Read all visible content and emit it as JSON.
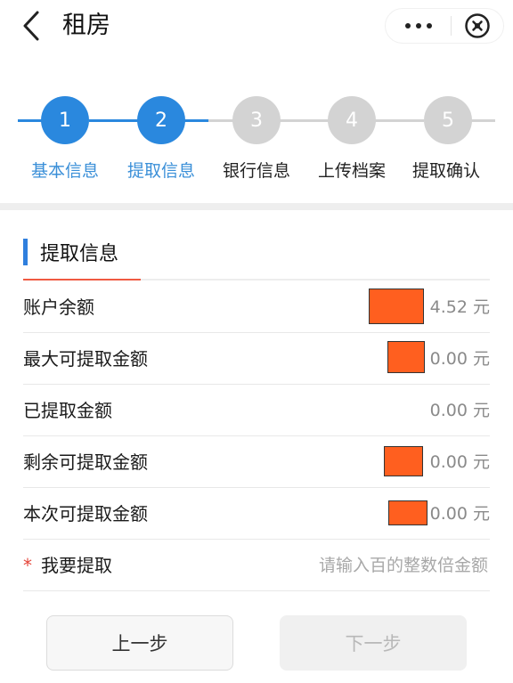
{
  "header": {
    "title": "租房",
    "back_icon": "chevron-left-icon",
    "more_icon": "more-dots-icon",
    "close_icon": "close-circle-icon"
  },
  "colors": {
    "accent": "#2a88de",
    "inactive_step": "#d3d3d3",
    "active_label": "#3a8fd8",
    "inactive_label": "#222222",
    "section_bar": "#2f7fde",
    "section_underline_accent": "#f05a42",
    "required_star": "#e4453a",
    "redaction": "#ff5f1f"
  },
  "stepper": {
    "steps": [
      {
        "number": "1",
        "label": "基本信息",
        "state": "done"
      },
      {
        "number": "2",
        "label": "提取信息",
        "state": "current"
      },
      {
        "number": "3",
        "label": "银行信息",
        "state": "pending"
      },
      {
        "number": "4",
        "label": "上传档案",
        "state": "pending"
      },
      {
        "number": "5",
        "label": "提取确认",
        "state": "pending"
      }
    ]
  },
  "section": {
    "title": "提取信息"
  },
  "fields": [
    {
      "label": "账户余额",
      "value": "4.52 元",
      "redacted": true
    },
    {
      "label": "最大可提取金额",
      "value": "0.00 元",
      "redacted": true
    },
    {
      "label": "已提取金额",
      "value": "0.00 元",
      "redacted": false
    },
    {
      "label": "剩余可提取金额",
      "value": "0.00 元",
      "redacted": true
    },
    {
      "label": "本次可提取金额",
      "value": "0.00 元",
      "redacted": true
    }
  ],
  "withdraw_input": {
    "required_mark": "*",
    "label": "我要提取",
    "placeholder": "请输入百的整数倍金额",
    "value": ""
  },
  "buttons": {
    "prev_label": "上一步",
    "next_label": "下一步",
    "next_enabled": false
  }
}
